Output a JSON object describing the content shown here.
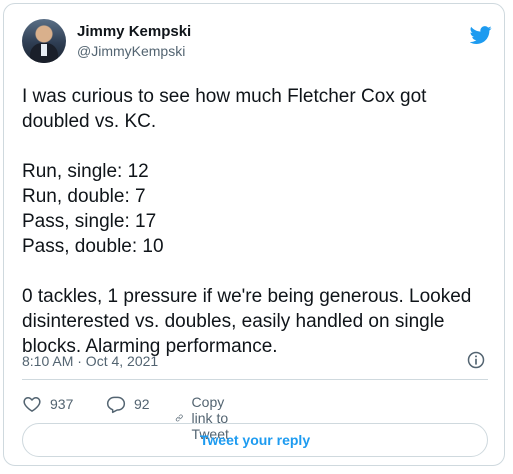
{
  "author": {
    "name": "Jimmy Kempski",
    "handle": "@JimmyKempski"
  },
  "tweet": {
    "text": "I was curious to see how much Fletcher Cox got doubled vs. KC.\n\nRun, single: 12\nRun, double: 7\nPass, single: 17\nPass, double: 10\n\n0 tackles, 1 pressure if we're being generous. Looked disinterested vs. doubles, easily handled on single blocks. Alarming performance.",
    "timestamp": "8:10 AM · Oct 4, 2021"
  },
  "actions": {
    "likes": "937",
    "replies": "92",
    "copy_link": "Copy link to Tweet"
  },
  "reply_button": "Tweet your reply",
  "icons": {
    "logo": "twitter-bird-icon",
    "info": "info-icon",
    "like": "heart-icon",
    "reply": "reply-bubble-icon",
    "link": "link-icon"
  },
  "colors": {
    "brand": "#1d9bf0",
    "text": "#0f1419",
    "muted": "#536471",
    "border": "#cfd9de"
  }
}
